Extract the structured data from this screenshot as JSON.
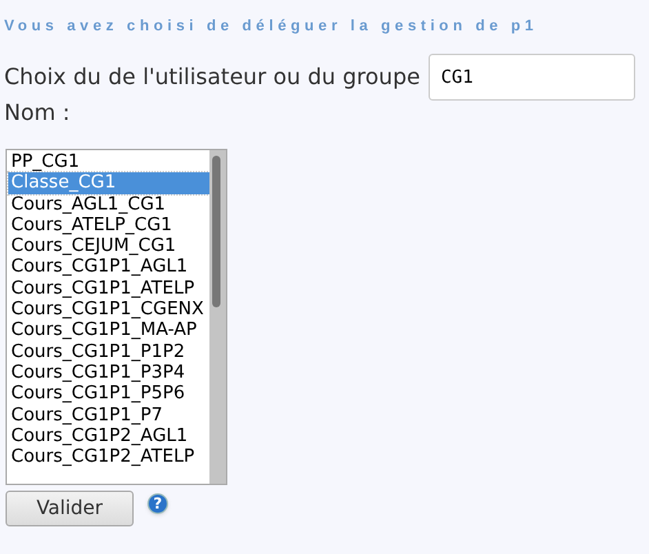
{
  "heading": "Vous avez choisi de déléguer la gestion de p1",
  "search": {
    "label": "Choix du de l'utilisateur ou du groupe",
    "value": "CG1"
  },
  "name_label": "Nom :",
  "list": [
    {
      "label": "PP_CG1",
      "selected": false
    },
    {
      "label": "Classe_CG1",
      "selected": true
    },
    {
      "label": "Cours_AGL1_CG1",
      "selected": false
    },
    {
      "label": "Cours_ATELP_CG1",
      "selected": false
    },
    {
      "label": "Cours_CEJUM_CG1",
      "selected": false
    },
    {
      "label": "Cours_CG1P1_AGL1",
      "selected": false
    },
    {
      "label": "Cours_CG1P1_ATELP",
      "selected": false
    },
    {
      "label": "Cours_CG1P1_CGENX",
      "selected": false
    },
    {
      "label": "Cours_CG1P1_MA-AP",
      "selected": false
    },
    {
      "label": "Cours_CG1P1_P1P2",
      "selected": false
    },
    {
      "label": "Cours_CG1P1_P3P4",
      "selected": false
    },
    {
      "label": "Cours_CG1P1_P5P6",
      "selected": false
    },
    {
      "label": "Cours_CG1P1_P7",
      "selected": false
    },
    {
      "label": "Cours_CG1P2_AGL1",
      "selected": false
    },
    {
      "label": "Cours_CG1P2_ATELP",
      "selected": false
    }
  ],
  "submit": "Valider",
  "help": "?"
}
